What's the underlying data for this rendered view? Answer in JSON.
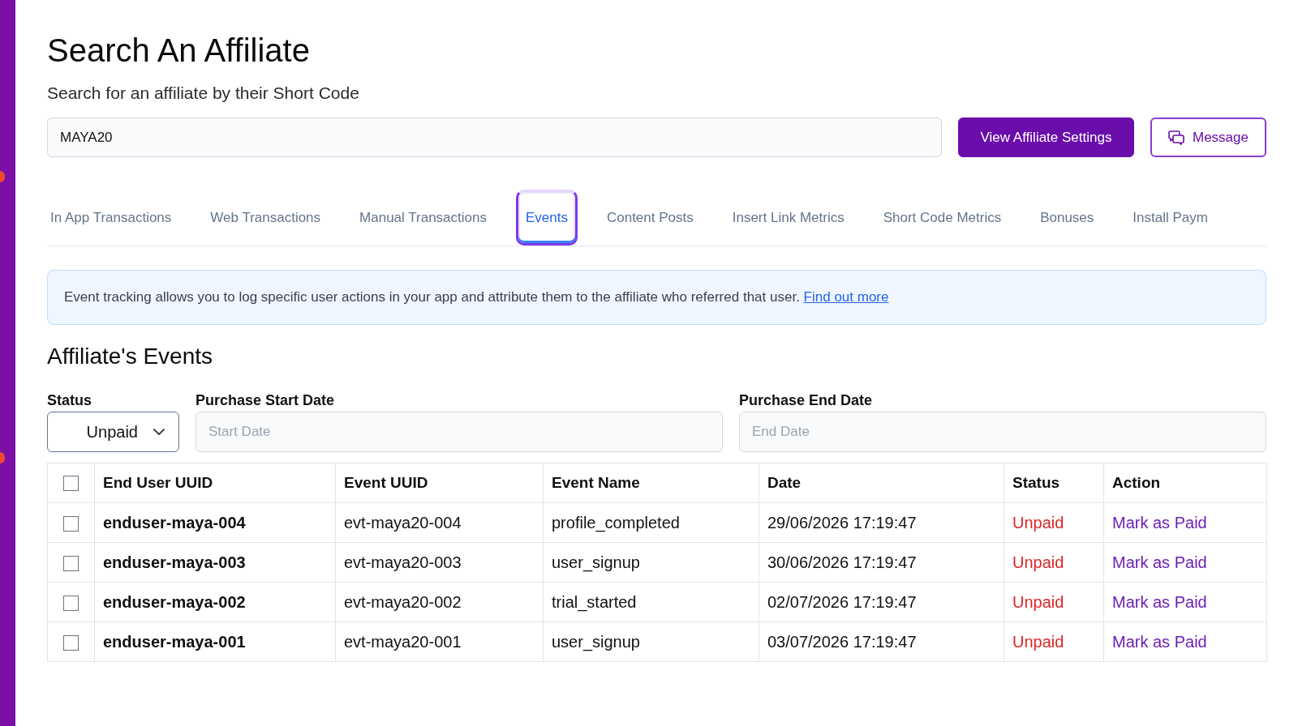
{
  "page": {
    "title": "Search An Affiliate",
    "subtitle": "Search for an affiliate by their Short Code"
  },
  "search": {
    "value": "MAYA20"
  },
  "buttons": [
    {
      "label": "View Affiliate Settings",
      "kind": "primary"
    },
    {
      "label": "Message",
      "kind": "outline"
    }
  ],
  "tabs": [
    {
      "label": "In App Transactions",
      "selected": false,
      "focused": false
    },
    {
      "label": "Web Transactions",
      "selected": false,
      "focused": false
    },
    {
      "label": "Manual Transactions",
      "selected": false,
      "focused": false
    },
    {
      "label": "Events",
      "selected": true,
      "focused": true
    },
    {
      "label": "Content Posts",
      "selected": false,
      "focused": false
    },
    {
      "label": "Insert Link Metrics",
      "selected": false,
      "focused": false
    },
    {
      "label": "Short Code Metrics",
      "selected": false,
      "focused": false
    },
    {
      "label": "Bonuses",
      "selected": false,
      "focused": false
    },
    {
      "label": "Install Paym",
      "selected": false,
      "focused": false
    }
  ],
  "notice": {
    "text": "Event tracking allows you to log specific user actions in your app and attribute them to the affiliate who referred that user.",
    "link": "Find out more"
  },
  "section_title": "Affiliate's Events",
  "filters": [
    {
      "kind": "select",
      "label": "Status",
      "value": "Unpaid"
    },
    {
      "kind": "date",
      "label": "Purchase Start Date",
      "placeholder": "Start Date"
    },
    {
      "kind": "date",
      "label": "Purchase End Date",
      "placeholder": "End Date"
    }
  ],
  "table": {
    "select_all": {
      "checked": false
    },
    "columns": [
      "End User UUID",
      "Event UUID",
      "Event Name",
      "Date",
      "Status",
      "Action"
    ],
    "rows": [
      {
        "checked": false,
        "end_user_uuid": "enduser-maya-004",
        "event_uuid": "evt-maya20-004",
        "event_name": "profile_completed",
        "date": "29/06/2026 17:19:47",
        "status": {
          "text": "Unpaid",
          "kind": "unpaid"
        },
        "action": "Mark as Paid"
      },
      {
        "checked": false,
        "end_user_uuid": "enduser-maya-003",
        "event_uuid": "evt-maya20-003",
        "event_name": "user_signup",
        "date": "30/06/2026 17:19:47",
        "status": {
          "text": "Unpaid",
          "kind": "unpaid"
        },
        "action": "Mark as Paid"
      },
      {
        "checked": false,
        "end_user_uuid": "enduser-maya-002",
        "event_uuid": "evt-maya20-002",
        "event_name": "trial_started",
        "date": "02/07/2026 17:19:47",
        "status": {
          "text": "Unpaid",
          "kind": "unpaid"
        },
        "action": "Mark as Paid"
      },
      {
        "checked": false,
        "end_user_uuid": "enduser-maya-001",
        "event_uuid": "evt-maya20-001",
        "event_name": "user_signup",
        "date": "03/07/2026 17:19:47",
        "status": {
          "text": "Unpaid",
          "kind": "unpaid"
        },
        "action": "Mark as Paid"
      }
    ]
  }
}
